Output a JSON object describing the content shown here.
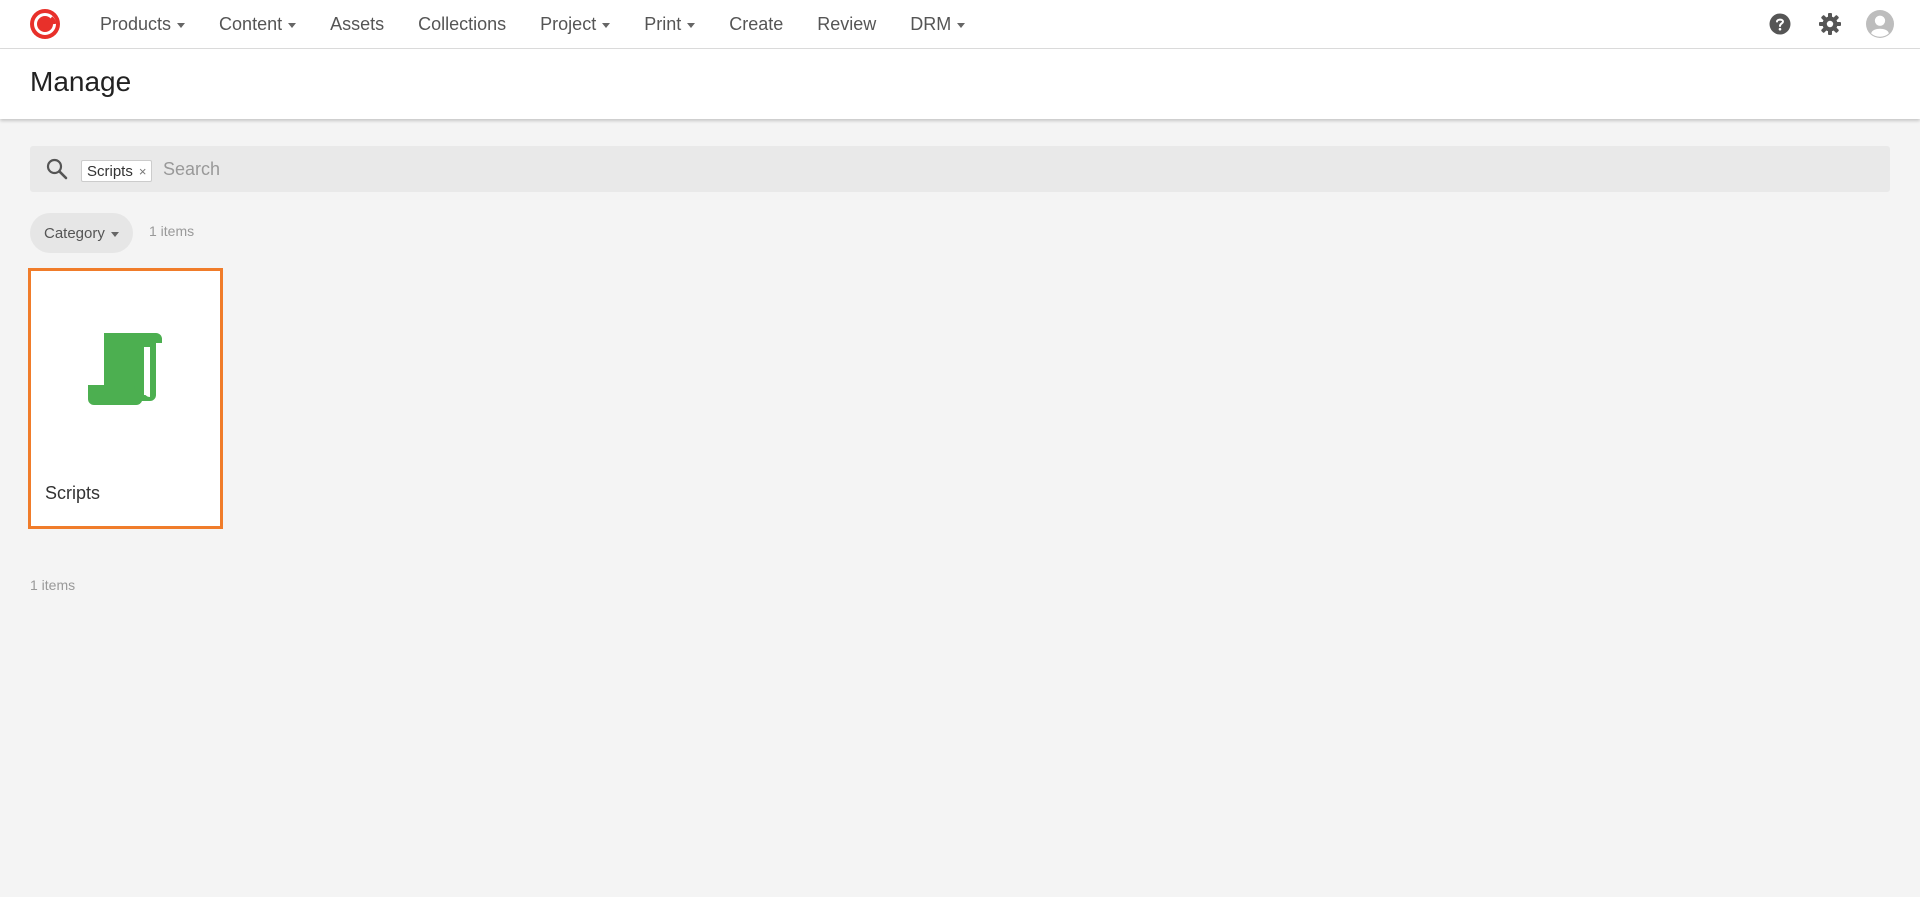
{
  "nav": {
    "items": [
      {
        "label": "Products",
        "dropdown": true
      },
      {
        "label": "Content",
        "dropdown": true
      },
      {
        "label": "Assets",
        "dropdown": false
      },
      {
        "label": "Collections",
        "dropdown": false
      },
      {
        "label": "Project",
        "dropdown": true
      },
      {
        "label": "Print",
        "dropdown": true
      },
      {
        "label": "Create",
        "dropdown": false
      },
      {
        "label": "Review",
        "dropdown": false
      },
      {
        "label": "DRM",
        "dropdown": true
      }
    ],
    "icons": [
      "help-icon",
      "gear-icon",
      "user-avatar-icon"
    ]
  },
  "page": {
    "title": "Manage"
  },
  "search": {
    "chip_label": "Scripts",
    "chip_remove": "×",
    "placeholder": "Search",
    "value": ""
  },
  "filters": {
    "category_label": "Category",
    "count_text": "1 items"
  },
  "items": [
    {
      "label": "Scripts",
      "icon": "scroll-icon",
      "icon_color": "#4caf50",
      "selected": true
    }
  ],
  "footer": {
    "count_text": "1 items"
  },
  "colors": {
    "accent": "#f07c2a",
    "logo": "#e8302a",
    "icon_green": "#4caf50"
  }
}
